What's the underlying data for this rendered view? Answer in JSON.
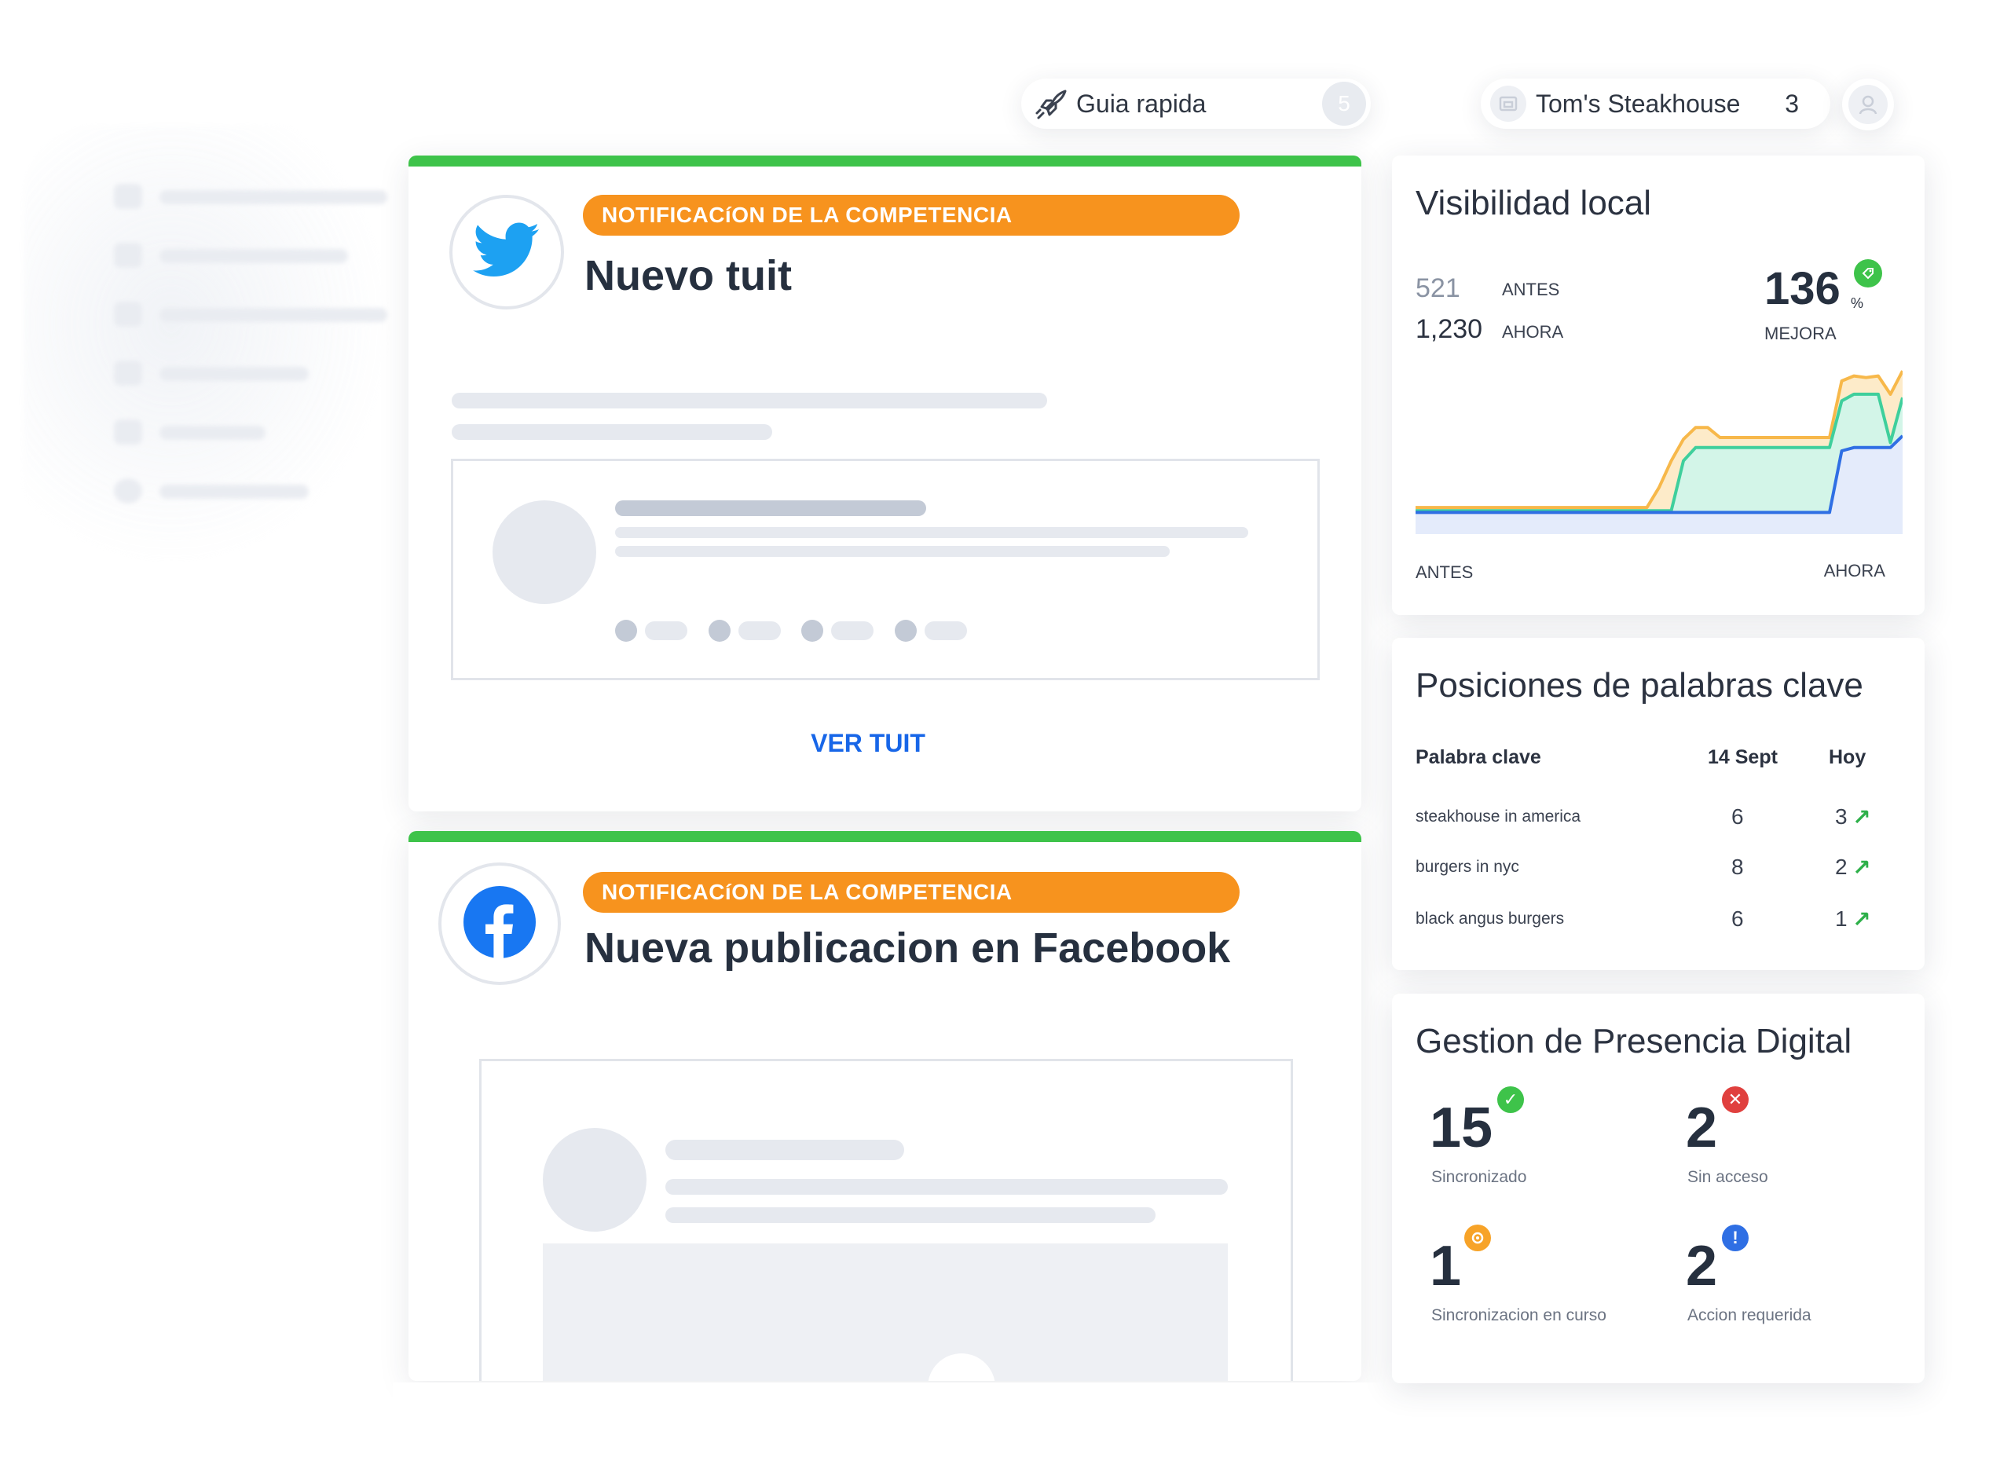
{
  "topbar": {
    "guide_label": "Guia rapida",
    "guide_count": "5",
    "business_name": "Tom's Steakhouse",
    "business_count": "3"
  },
  "feed": {
    "twitter_card": {
      "badge": "NOTIFICACíON DE LA COMPETENCIA",
      "title": "Nuevo tuit",
      "action": "VER TUIT"
    },
    "facebook_card": {
      "badge": "NOTIFICACíON DE LA COMPETENCIA",
      "title": "Nueva publicacion en Facebook"
    }
  },
  "local_visibility": {
    "title": "Visibilidad local",
    "before_value": "521",
    "before_label": "ANTES",
    "now_value": "1,230",
    "now_label": "AHORA",
    "improvement_value": "136",
    "improvement_unit": "%",
    "improvement_label": "MEJORA",
    "axis_start": "ANTES",
    "axis_end": "AHORA",
    "colors": {
      "orange": "#f7b84a",
      "teal": "#3fcf9c",
      "blue": "#2f6fe4"
    }
  },
  "chart_data": {
    "type": "area",
    "title": "Visibilidad local",
    "xlabel": "",
    "ylabel": "",
    "x_tick_labels": [
      "ANTES",
      "AHORA"
    ],
    "ylim": [
      0,
      100
    ],
    "grid": false,
    "x": [
      0,
      1,
      2,
      3,
      4,
      5,
      6,
      7,
      8,
      9,
      10,
      11,
      12,
      13,
      14,
      15,
      16,
      17,
      18,
      19,
      20,
      21,
      22,
      23,
      24,
      25,
      26,
      27,
      28,
      29,
      30,
      31,
      32,
      33,
      34,
      35,
      36,
      37,
      38,
      39,
      40
    ],
    "series": [
      {
        "color": "#f7b84a",
        "values": [
          16,
          16,
          16,
          16,
          16,
          16,
          16,
          16,
          16,
          16,
          16,
          16,
          16,
          16,
          16,
          16,
          16,
          16,
          16,
          16,
          28,
          44,
          57,
          64,
          64,
          58,
          58,
          58,
          58,
          58,
          58,
          58,
          58,
          58,
          58,
          92,
          95,
          94,
          95,
          84,
          98
        ]
      },
      {
        "color": "#3fcf9c",
        "values": [
          14,
          14,
          14,
          14,
          14,
          14,
          14,
          14,
          14,
          14,
          14,
          14,
          14,
          14,
          14,
          14,
          14,
          14,
          14,
          14,
          14,
          14,
          44,
          52,
          52,
          52,
          52,
          52,
          52,
          52,
          52,
          52,
          52,
          52,
          52,
          80,
          84,
          84,
          84,
          55,
          82
        ]
      },
      {
        "color": "#2f6fe4",
        "values": [
          13,
          13,
          13,
          13,
          13,
          13,
          13,
          13,
          13,
          13,
          13,
          13,
          13,
          13,
          13,
          13,
          13,
          13,
          13,
          13,
          13,
          13,
          13,
          13,
          13,
          13,
          13,
          13,
          13,
          13,
          13,
          13,
          13,
          13,
          13,
          50,
          52,
          52,
          52,
          52,
          59
        ]
      }
    ]
  },
  "keywords": {
    "title": "Posiciones de palabras clave",
    "headers": [
      "Palabra clave",
      "14 Sept",
      "Hoy"
    ],
    "rows": [
      {
        "keyword": "steakhouse in america",
        "before": "6",
        "today": "3"
      },
      {
        "keyword": "burgers in nyc",
        "before": "8",
        "today": "2"
      },
      {
        "keyword": "black angus burgers",
        "before": "6",
        "today": "1"
      }
    ]
  },
  "presence": {
    "title": "Gestion de Presencia Digital",
    "stats": [
      {
        "value": "15",
        "label": "Sincronizado",
        "status": "check",
        "color": "#3ec34a"
      },
      {
        "value": "2",
        "label": "Sin acceso",
        "status": "cross",
        "color": "#e0403e"
      },
      {
        "value": "1",
        "label": "Sincronizacion en curso",
        "status": "sync",
        "color": "#f7a328"
      },
      {
        "value": "2",
        "label": "Accion requerida",
        "status": "info",
        "color": "#2f6fe4"
      }
    ]
  }
}
